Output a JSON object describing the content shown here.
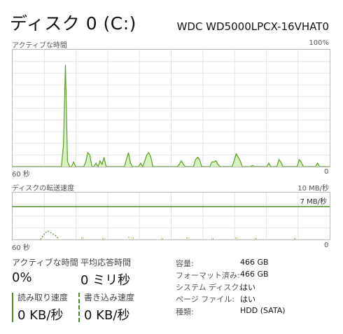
{
  "header": {
    "title": "ディスク 0 (C:)",
    "model": "WDC WD5000LPCX-16VHAT0"
  },
  "active_time_graph": {
    "label": "アクティブな時間",
    "max_label": "100%",
    "x_left": "60 秒",
    "x_right": "0",
    "fill_color": "#d9f0c2",
    "line_color": "#5a9e22",
    "values": [
      0,
      0,
      0,
      0,
      0,
      0,
      0,
      0,
      0,
      0,
      0,
      0,
      0,
      0,
      0,
      0,
      0,
      0,
      0,
      0,
      0,
      0,
      0,
      0,
      0,
      18,
      87,
      5,
      0,
      0,
      4,
      0,
      0,
      0,
      0,
      0,
      4,
      12,
      10,
      0,
      0,
      3,
      0,
      5,
      2,
      8,
      0,
      0,
      0,
      0,
      0,
      0,
      0,
      0,
      0,
      0,
      6,
      12,
      3,
      0,
      0,
      0,
      0,
      3,
      0,
      5,
      10,
      12,
      8,
      0,
      0,
      0,
      0,
      0,
      0,
      0,
      0,
      0,
      0,
      0,
      0,
      0,
      2,
      5,
      2,
      0,
      0,
      0,
      0,
      0,
      6,
      8,
      6,
      0,
      0,
      0,
      0,
      0,
      4,
      4,
      5,
      2,
      0,
      0,
      0,
      0,
      0,
      0,
      0,
      5,
      11,
      8,
      5,
      0,
      0,
      0,
      0,
      0,
      1,
      0,
      0,
      0,
      0,
      0,
      0,
      0,
      3,
      0,
      0,
      0,
      0,
      6,
      4,
      0,
      0,
      0,
      0,
      0,
      0,
      0,
      0,
      6,
      4,
      0,
      0,
      0,
      0,
      0,
      0,
      0,
      3,
      0,
      0,
      0,
      0,
      0,
      0
    ]
  },
  "transfer_graph": {
    "label": "ディスクの転送速度",
    "max_label": "10 MB/秒",
    "ref_label": "7 MB/秒",
    "x_left": "60 秒",
    "x_right": "0",
    "line_color": "#4e8a1e",
    "ref_fraction": 0.7
  },
  "stats": {
    "active_time_label": "アクティブな時間",
    "active_time_value": "0%",
    "response_label": "平均応答時間",
    "response_value": "0 ミリ秒",
    "read_label": "読み取り速度",
    "read_value": "0 KB/秒",
    "write_label": "書き込み速度",
    "write_value": "0 KB/秒"
  },
  "properties": {
    "capacity_label": "容量:",
    "capacity_value": "466 GB",
    "formatted_label": "フォーマット済み:",
    "formatted_value": "466 GB",
    "system_label": "システム ディスク:",
    "system_value": "はい",
    "pagefile_label": "ページ ファイル:",
    "pagefile_value": "はい",
    "type_label": "種類:",
    "type_value": "HDD (SATA)"
  }
}
